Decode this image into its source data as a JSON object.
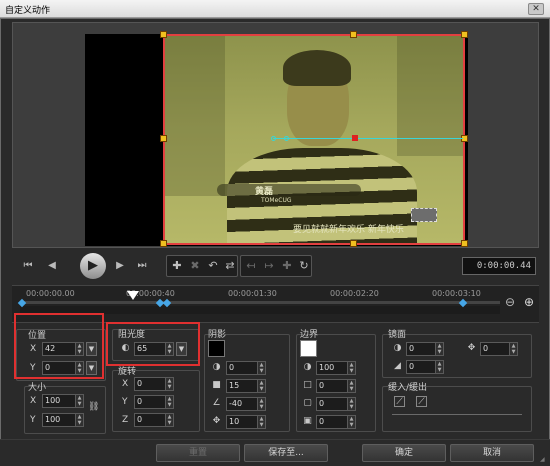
{
  "window": {
    "title": "自定义动作",
    "close": "✕"
  },
  "preview": {
    "name_tag": "黄磊",
    "name_tag_sub": "TOMeCUG",
    "subtitle": "要见就就新年欢乐 新年快乐"
  },
  "playback": {
    "timecode": "0:00:00.44",
    "icons": [
      "go-to-start-icon",
      "previous-frame-icon",
      "play-icon",
      "next-frame-icon",
      "go-to-end-icon"
    ]
  },
  "tools": {
    "icons": [
      "add-keyframe-icon",
      "remove-keyframe-icon",
      "reverse-keyframes-icon",
      "flip-keyframes-icon",
      "move-left-icon",
      "move-right-icon",
      "reset-keyframe-icon"
    ]
  },
  "ruler": {
    "ticks": [
      "00:00:00.00",
      "00:00:00:40",
      "00:00:01:30",
      "00:00:02:20",
      "00:00:03:10"
    ]
  },
  "position": {
    "label": "位置",
    "x_axis": "X",
    "y_axis": "Y",
    "x": "42",
    "y": "0"
  },
  "size": {
    "label": "大小",
    "x_axis": "X",
    "y_axis": "Y",
    "x": "100",
    "y": "100"
  },
  "opacity": {
    "label": "阻光度",
    "value": "65"
  },
  "rotation": {
    "label": "旋转",
    "x_axis": "X",
    "y_axis": "Y",
    "z_axis": "Z",
    "x": "0",
    "y": "0",
    "z": "0"
  },
  "shadow": {
    "label": "阴影",
    "color": "#000000",
    "values": [
      "0",
      "15",
      "-40",
      "10"
    ]
  },
  "border": {
    "label": "边界",
    "color": "#ffffff",
    "values": [
      "100",
      "0",
      "0",
      "0"
    ]
  },
  "mirror": {
    "label": "镜面",
    "values": [
      "0",
      "0",
      "0"
    ]
  },
  "ease": {
    "label": "缓入/缓出"
  },
  "buttons": {
    "reset": "重置",
    "save_to": "保存至...",
    "ok": "确定",
    "cancel": "取消"
  }
}
